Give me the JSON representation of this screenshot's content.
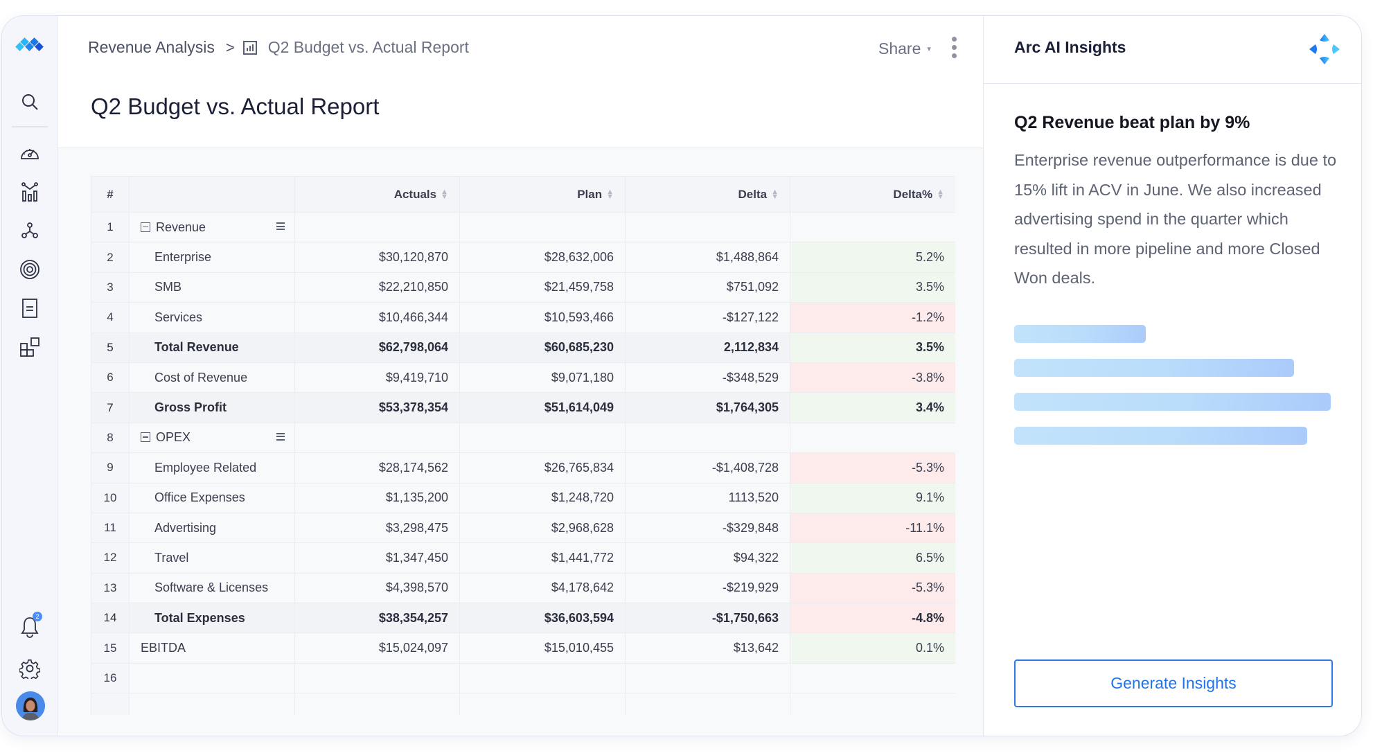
{
  "sidebar": {
    "logo": "app-logo",
    "items": [
      {
        "name": "search",
        "icon": "search-icon"
      },
      {
        "name": "dashboards",
        "icon": "speedometer-icon"
      },
      {
        "name": "analytics",
        "icon": "chart-icon"
      },
      {
        "name": "integrations",
        "icon": "network-icon"
      },
      {
        "name": "goals",
        "icon": "target-icon"
      },
      {
        "name": "reports",
        "icon": "document-icon"
      },
      {
        "name": "apps",
        "icon": "grid-icon"
      }
    ],
    "notifications": {
      "icon": "bell-icon",
      "count": "2"
    },
    "settings": {
      "icon": "gear-icon"
    },
    "avatar": "user-avatar"
  },
  "header": {
    "breadcrumb_root": "Revenue Analysis",
    "breadcrumb_separator": ">",
    "breadcrumb_current": "Q2 Budget vs. Actual Report",
    "page_title": "Q2 Budget vs. Actual Report",
    "share_label": "Share",
    "share_caret": "▾"
  },
  "table": {
    "columns": [
      "#",
      "",
      "Actuals",
      "Plan",
      "Delta",
      "Delta%"
    ],
    "sort_glyph": "⬍",
    "rows": [
      {
        "num": "1",
        "label": "Revenue",
        "type": "group",
        "actuals": "",
        "plan": "",
        "delta": "",
        "delta_pct": "",
        "status": ""
      },
      {
        "num": "2",
        "label": "Enterprise",
        "type": "item",
        "actuals": "$30,120,870",
        "plan": "$28,632,006",
        "delta": "$1,488,864",
        "delta_pct": "5.2%",
        "status": "pos"
      },
      {
        "num": "3",
        "label": "SMB",
        "type": "item",
        "actuals": "$22,210,850",
        "plan": "$21,459,758",
        "delta": "$751,092",
        "delta_pct": "3.5%",
        "status": "pos"
      },
      {
        "num": "4",
        "label": "Services",
        "type": "item",
        "actuals": "$10,466,344",
        "plan": "$10,593,466",
        "delta": "-$127,122",
        "delta_pct": "-1.2%",
        "status": "neg"
      },
      {
        "num": "5",
        "label": "Total Revenue",
        "type": "total",
        "actuals": "$62,798,064",
        "plan": "$60,685,230",
        "delta": "2,112,834",
        "delta_pct": "3.5%",
        "status": "pos"
      },
      {
        "num": "6",
        "label": "Cost of Revenue",
        "type": "item",
        "actuals": "$9,419,710",
        "plan": "$9,071,180",
        "delta": "-$348,529",
        "delta_pct": "-3.8%",
        "status": "neg"
      },
      {
        "num": "7",
        "label": "Gross Profit",
        "type": "total",
        "actuals": "$53,378,354",
        "plan": "$51,614,049",
        "delta": "$1,764,305",
        "delta_pct": "3.4%",
        "status": "pos"
      },
      {
        "num": "8",
        "label": "OPEX",
        "type": "group",
        "actuals": "",
        "plan": "",
        "delta": "",
        "delta_pct": "",
        "status": ""
      },
      {
        "num": "9",
        "label": "Employee Related",
        "type": "item",
        "actuals": "$28,174,562",
        "plan": "$26,765,834",
        "delta": "-$1,408,728",
        "delta_pct": "-5.3%",
        "status": "neg"
      },
      {
        "num": "10",
        "label": "Office Expenses",
        "type": "item",
        "actuals": "$1,135,200",
        "plan": "$1,248,720",
        "delta": "1113,520",
        "delta_pct": "9.1%",
        "status": "pos"
      },
      {
        "num": "11",
        "label": "Advertising",
        "type": "item",
        "actuals": "$3,298,475",
        "plan": "$2,968,628",
        "delta": "-$329,848",
        "delta_pct": "-11.1%",
        "status": "neg"
      },
      {
        "num": "12",
        "label": "Travel",
        "type": "item",
        "actuals": "$1,347,450",
        "plan": "$1,441,772",
        "delta": "$94,322",
        "delta_pct": "6.5%",
        "status": "pos"
      },
      {
        "num": "13",
        "label": "Software & Licenses",
        "type": "item",
        "actuals": "$4,398,570",
        "plan": "$4,178,642",
        "delta": "-$219,929",
        "delta_pct": "-5.3%",
        "status": "neg"
      },
      {
        "num": "14",
        "label": "Total Expenses",
        "type": "total",
        "actuals": "$38,354,257",
        "plan": "$36,603,594",
        "delta": "-$1,750,663",
        "delta_pct": "-4.8%",
        "status": "neg"
      },
      {
        "num": "15",
        "label": "EBITDA",
        "type": "top",
        "actuals": "$15,024,097",
        "plan": "$15,010,455",
        "delta": "$13,642",
        "delta_pct": "0.1%",
        "status": "pos"
      },
      {
        "num": "16",
        "label": "",
        "type": "top",
        "actuals": "",
        "plan": "",
        "delta": "",
        "delta_pct": "",
        "status": ""
      },
      {
        "num": "",
        "label": "",
        "type": "top",
        "actuals": "",
        "plan": "",
        "delta": "",
        "delta_pct": "",
        "status": ""
      }
    ]
  },
  "insights": {
    "panel_title": "Arc AI Insights",
    "headline": "Q2 Revenue beat plan by 9%",
    "body": "Enterprise revenue outperformance is due to 15% lift in ACV in June. We also increased advertising spend in the quarter which resulted in more pipeline and more Closed Won deals.",
    "loading_placeholder_lines": 4,
    "generate_button": "Generate Insights"
  },
  "colors": {
    "accent": "#2c7be5",
    "positive_bg": "#eff7ee",
    "negative_bg": "#fdeaea",
    "badge": "#4d8ef5"
  }
}
